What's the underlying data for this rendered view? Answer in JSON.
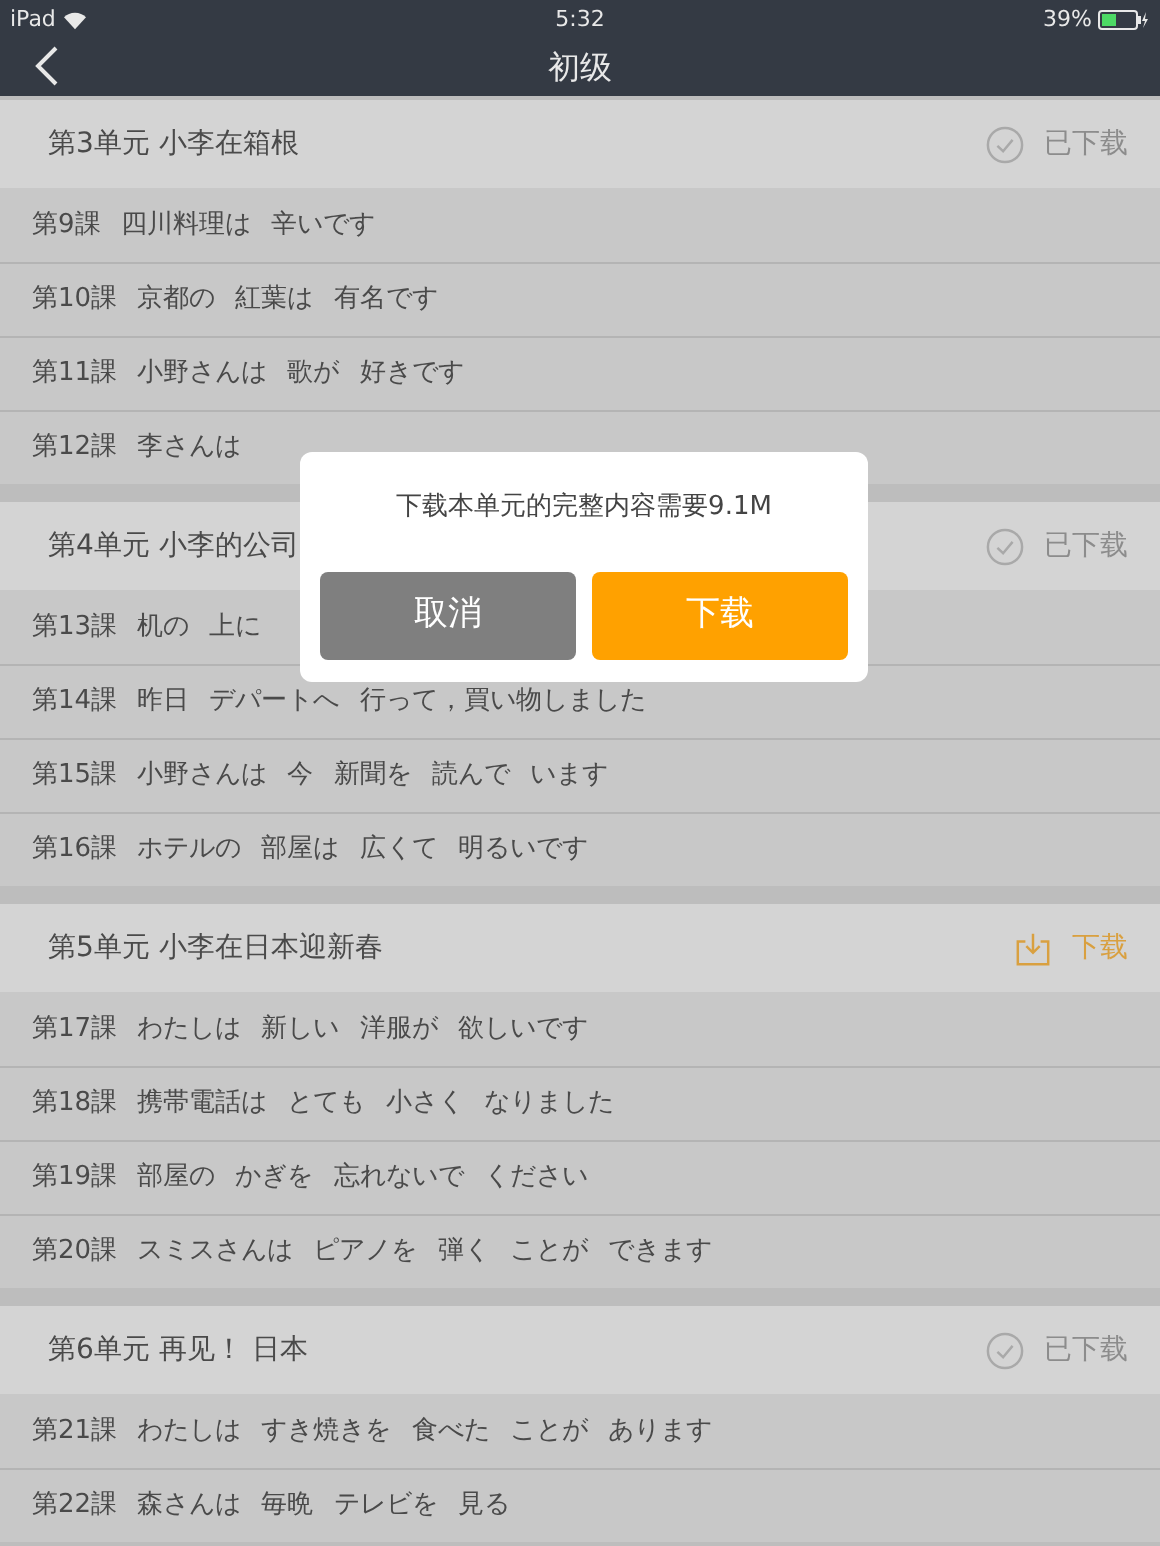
{
  "status_bar": {
    "device": "iPad",
    "time": "5:32",
    "battery": "39%"
  },
  "nav": {
    "title": "初级"
  },
  "units": [
    {
      "title": "第3单元 小李在箱根",
      "status": {
        "kind": "downloaded",
        "label": "已下载"
      },
      "lessons": [
        {
          "number": "第9課",
          "title": "四川料理は 辛いです"
        },
        {
          "number": "第10課",
          "title": "京都の 紅葉は 有名です"
        },
        {
          "number": "第11課",
          "title": "小野さんは 歌が 好きです"
        },
        {
          "number": "第12課",
          "title": "李さんは"
        }
      ]
    },
    {
      "title": "第4单元 小李的公司",
      "status": {
        "kind": "downloaded",
        "label": "已下载"
      },
      "lessons": [
        {
          "number": "第13課",
          "title": "机の 上に"
        },
        {
          "number": "第14課",
          "title": "昨日 デパートへ 行って，買い物しました"
        },
        {
          "number": "第15課",
          "title": "小野さんは 今 新聞を 読んで います"
        },
        {
          "number": "第16課",
          "title": "ホテルの 部屋は 広くて 明るいです"
        }
      ]
    },
    {
      "title": "第5单元 小李在日本迎新春",
      "status": {
        "kind": "download",
        "label": "下载"
      },
      "lessons": [
        {
          "number": "第17課",
          "title": "わたしは 新しい 洋服が 欲しいです"
        },
        {
          "number": "第18課",
          "title": "携帯電話は とても 小さく なりました"
        },
        {
          "number": "第19課",
          "title": "部屋の かぎを 忘れないで ください"
        },
        {
          "number": "第20課",
          "title": "スミスさんは ピアノを 弾く ことが できます"
        }
      ]
    },
    {
      "title": "第6单元 再见！ 日本",
      "status": {
        "kind": "downloaded",
        "label": "已下载"
      },
      "lessons": [
        {
          "number": "第21課",
          "title": "わたしは すき焼きを 食べた ことが あります"
        },
        {
          "number": "第22課",
          "title": "森さんは 毎晩 テレビを 見る"
        }
      ]
    }
  ],
  "dialog": {
    "message": "下载本单元的完整内容需要9.1M",
    "buttons": [
      {
        "kind": "cancel",
        "label": "取消"
      },
      {
        "kind": "confirm",
        "label": "下载"
      }
    ]
  }
}
